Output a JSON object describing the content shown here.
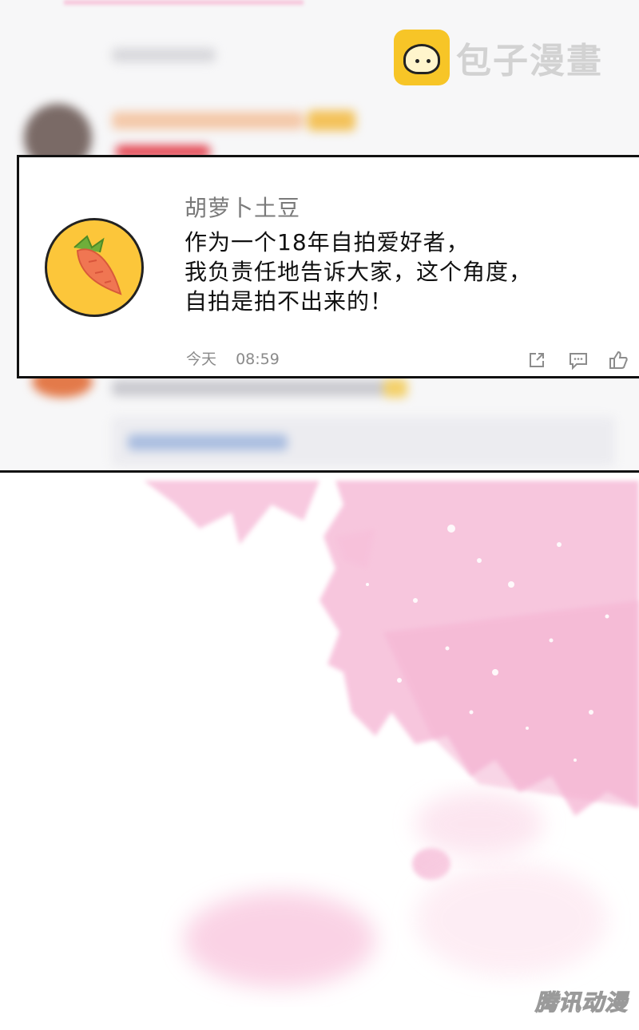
{
  "watermark": {
    "text": "包子漫畫",
    "icon": "bun-face-icon"
  },
  "comment": {
    "username": "胡萝卜土豆",
    "lines": [
      "作为一个18年自拍爱好者，",
      "我负责任地告诉大家，这个角度，",
      "自拍是拍不出来的！"
    ],
    "date": "今天",
    "time": "08:59",
    "avatar_icon": "carrot-icon",
    "action_icons": [
      "share-icon",
      "reply-icon",
      "like-icon"
    ]
  },
  "credit": {
    "text": "腾讯动漫"
  },
  "colors": {
    "avatar_bg": "#fcc63a",
    "splash": "#f7c0da",
    "watermark_icon": "#f7c527"
  }
}
